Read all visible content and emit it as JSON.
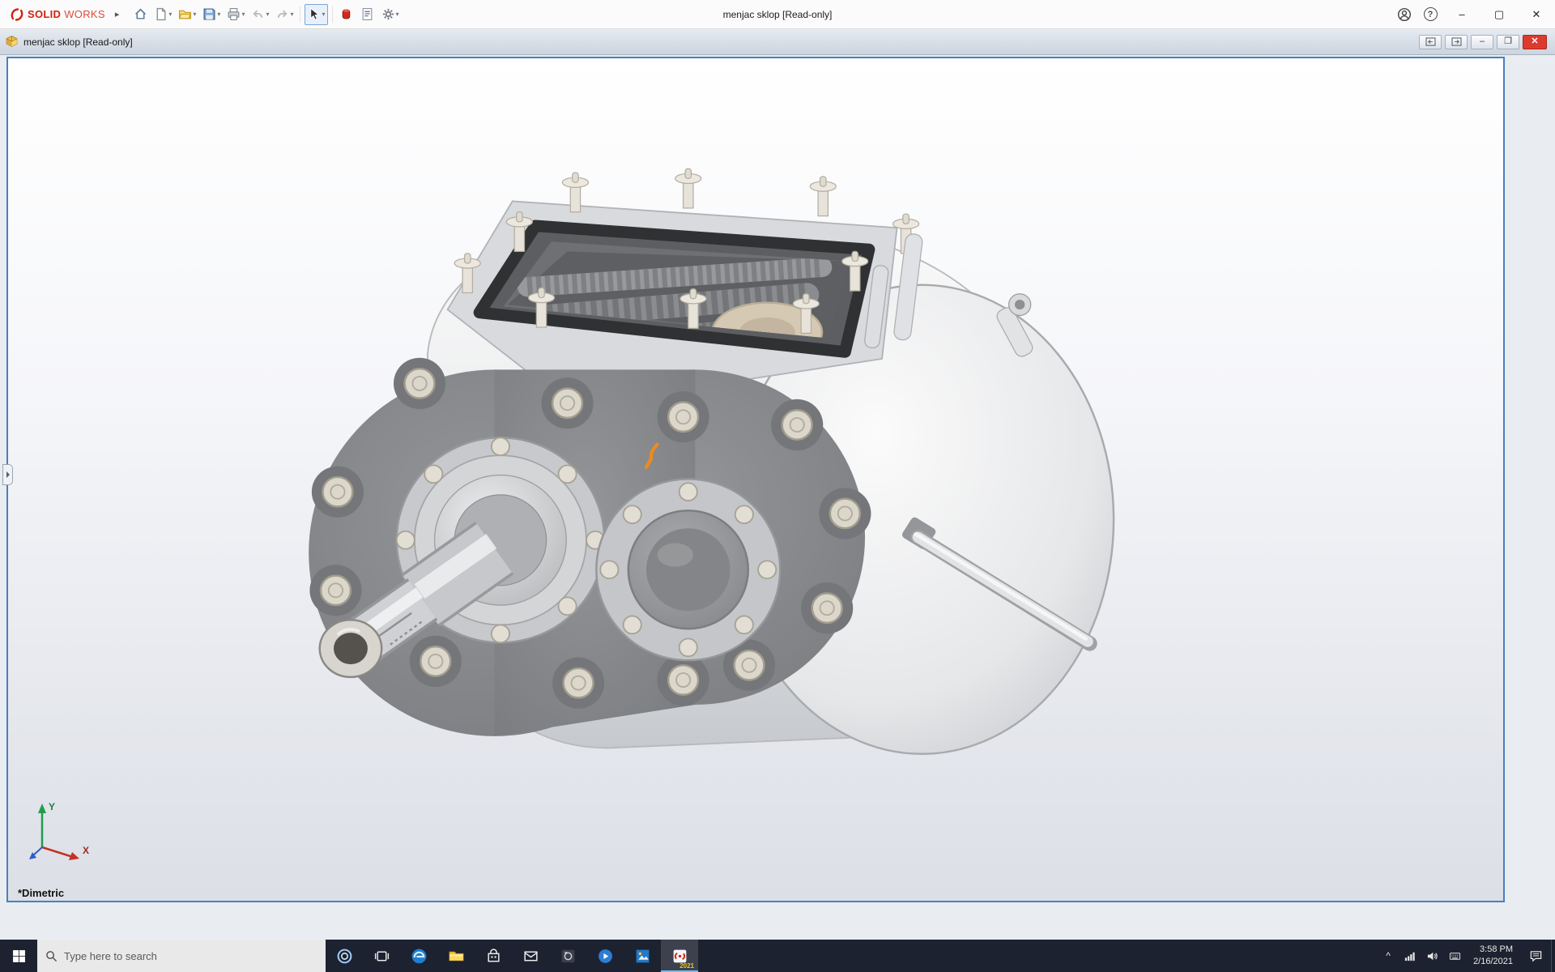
{
  "titlebar": {
    "brand": {
      "solid": "SOLID",
      "works": "WORKS"
    },
    "title": "menjac sklop [Read-only]"
  },
  "docbar": {
    "title": "menjac sklop [Read-only]"
  },
  "viewport": {
    "view_label": "*Dimetric",
    "triad": {
      "x_label": "X",
      "y_label": "Y"
    }
  },
  "taskbar": {
    "search_placeholder": "Type here to search",
    "solidworks_badge": "2021",
    "clock": {
      "time": "3:58 PM",
      "date": "2/16/2021"
    }
  },
  "icons": {
    "minimize": "–",
    "maximize": "▢",
    "restore": "❐",
    "close": "✕",
    "help": "?",
    "dropdown": "▾",
    "expand_arrow": "▸",
    "tray_chevron": "^"
  },
  "colors": {
    "brand_red": "#d4210f",
    "viewport_border": "#4a7fbe",
    "doc_close_red": "#dd3a2e",
    "taskbar_bg": "#1d2230",
    "active_indicator": "#76b9ed",
    "selection_orange": "#ee8a1c"
  }
}
